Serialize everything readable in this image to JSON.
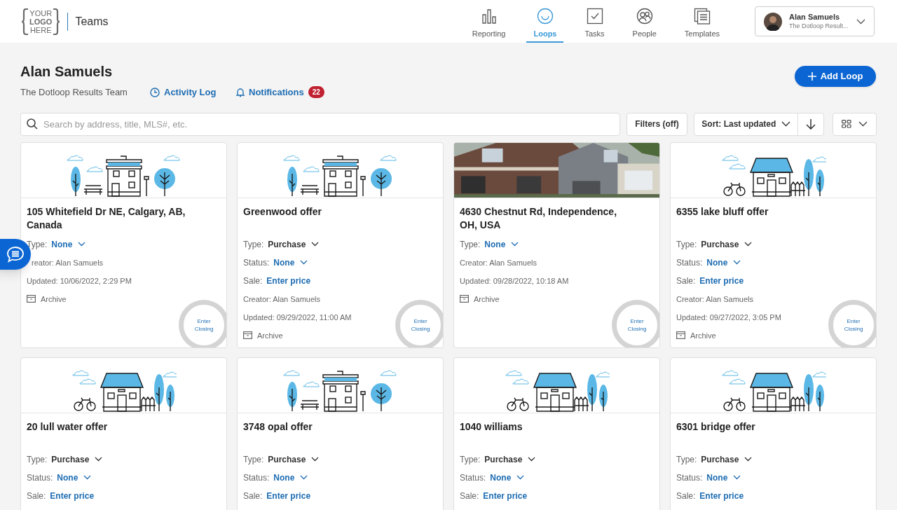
{
  "header": {
    "logo": {
      "line_1": "YOUR",
      "line_2": "LOGO",
      "line_3": "HERE"
    },
    "section": "Teams",
    "nav": [
      {
        "label": "Reporting",
        "selected": false
      },
      {
        "label": "Loops",
        "selected": true
      },
      {
        "label": "Tasks",
        "selected": false
      },
      {
        "label": "People",
        "selected": false
      },
      {
        "label": "Templates",
        "selected": false
      }
    ],
    "user": {
      "name": "Alan Samuels",
      "team": "The Dotloop Result..."
    }
  },
  "page": {
    "title": "Alan Samuels",
    "team": "The Dotloop Results Team",
    "activity_log": "Activity Log",
    "notifications": "Notifications",
    "notification_count": "22",
    "add_button": "Add Loop"
  },
  "toolbar": {
    "search": {
      "placeholder": "Search by address, title, MLS#, etc."
    },
    "filters": "Filters (off)",
    "sort": "Sort: Last updated"
  },
  "cards": [
    {
      "title": "105 Whitefield Dr NE, Calgary, AB, Canada",
      "fields": [
        {
          "kind": "dropdown",
          "label": "Type:",
          "value": "None",
          "set": false
        },
        {
          "kind": "covered",
          "label": "reator: Alan Samuels"
        },
        {
          "kind": "text",
          "label": "Updated: 10/06/2022, 2:29 PM"
        },
        {
          "kind": "archive",
          "label": "Archive"
        }
      ],
      "closing": "Enter Closing"
    },
    {
      "title": "Greenwood offer",
      "fields": [
        {
          "kind": "dropdown",
          "label": "Type:",
          "value": "Purchase",
          "set": true
        },
        {
          "kind": "dropdown",
          "label": "Status:",
          "value": "None",
          "set": false
        },
        {
          "kind": "link",
          "label": "Sale:",
          "value": "Enter price"
        },
        {
          "kind": "text",
          "label": "Creator: Alan Samuels"
        },
        {
          "kind": "text",
          "label": "Updated: 09/29/2022, 11:00 AM"
        },
        {
          "kind": "archive",
          "label": "Archive"
        }
      ],
      "closing": "Enter Closing"
    },
    {
      "title": "4630 Chestnut Rd, Independence, OH, USA",
      "fields": [
        {
          "kind": "dropdown",
          "label": "Type:",
          "value": "None",
          "set": false
        },
        {
          "kind": "text",
          "label": "Creator: Alan Samuels"
        },
        {
          "kind": "text",
          "label": "Updated: 09/28/2022, 10:18 AM"
        },
        {
          "kind": "archive",
          "label": "Archive"
        }
      ],
      "closing": "Enter Closing"
    },
    {
      "title": "6355 lake bluff offer",
      "fields": [
        {
          "kind": "dropdown",
          "label": "Type:",
          "value": "Purchase",
          "set": true
        },
        {
          "kind": "dropdown",
          "label": "Status:",
          "value": "None",
          "set": false
        },
        {
          "kind": "link",
          "label": "Sale:",
          "value": "Enter price"
        },
        {
          "kind": "text",
          "label": "Creator: Alan Samuels"
        },
        {
          "kind": "text",
          "label": "Updated: 09/27/2022, 3:05 PM"
        },
        {
          "kind": "archive",
          "label": "Archive"
        }
      ],
      "closing": "Enter Closing"
    },
    {
      "title": "20 lull water offer",
      "fields": [
        {
          "kind": "dropdown",
          "label": "Type:",
          "value": "Purchase",
          "set": true
        },
        {
          "kind": "dropdown",
          "label": "Status:",
          "value": "None",
          "set": false
        },
        {
          "kind": "link",
          "label": "Sale:",
          "value": "Enter price"
        }
      ]
    },
    {
      "title": "3748 opal offer",
      "fields": [
        {
          "kind": "dropdown",
          "label": "Type:",
          "value": "Purchase",
          "set": true
        },
        {
          "kind": "dropdown",
          "label": "Status:",
          "value": "None",
          "set": false
        },
        {
          "kind": "link",
          "label": "Sale:",
          "value": "Enter price"
        }
      ]
    },
    {
      "title": "1040 williams",
      "fields": [
        {
          "kind": "dropdown",
          "label": "Type:",
          "value": "Purchase",
          "set": true
        },
        {
          "kind": "dropdown",
          "label": "Status:",
          "value": "None",
          "set": false
        },
        {
          "kind": "link",
          "label": "Sale:",
          "value": "Enter price"
        }
      ]
    },
    {
      "title": "6301 bridge offer",
      "fields": [
        {
          "kind": "dropdown",
          "label": "Type:",
          "value": "Purchase",
          "set": true
        },
        {
          "kind": "dropdown",
          "label": "Status:",
          "value": "None",
          "set": false
        },
        {
          "kind": "link",
          "label": "Sale:",
          "value": "Enter price"
        }
      ]
    }
  ]
}
